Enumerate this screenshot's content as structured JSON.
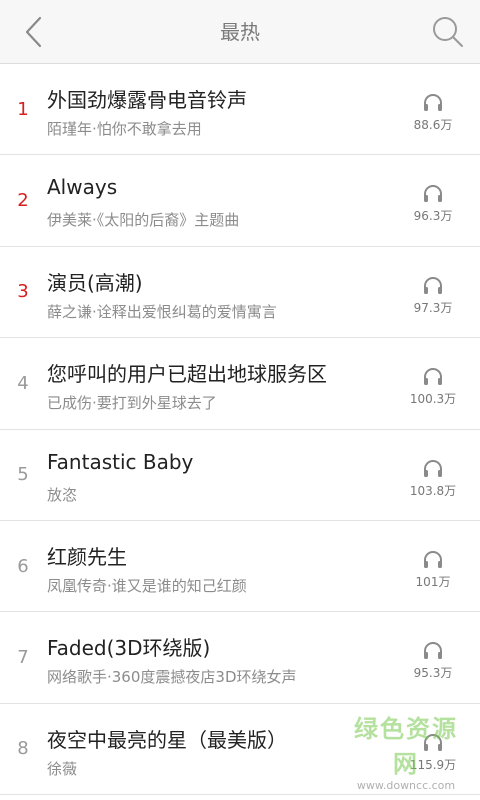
{
  "header": {
    "title": "最热"
  },
  "songs": [
    {
      "rank": "1",
      "title": "外国劲爆露骨电音铃声",
      "subtitle": "陌瑾年·怕你不敢拿去用",
      "plays": "88.6万"
    },
    {
      "rank": "2",
      "title": "Always",
      "subtitle": "伊美莱·《太阳的后裔》主题曲",
      "plays": "96.3万"
    },
    {
      "rank": "3",
      "title": "演员(高潮)",
      "subtitle": "薛之谦·诠释出爱恨纠葛的爱情寓言",
      "plays": "97.3万"
    },
    {
      "rank": "4",
      "title": "您呼叫的用户已超出地球服务区",
      "subtitle": "已成伤·要打到外星球去了",
      "plays": "100.3万"
    },
    {
      "rank": "5",
      "title": "Fantastic Baby",
      "subtitle": "放恣",
      "plays": "103.8万"
    },
    {
      "rank": "6",
      "title": "红颜先生",
      "subtitle": "凤凰传奇·谁又是谁的知己红颜",
      "plays": "101万"
    },
    {
      "rank": "7",
      "title": "Faded(3D环绕版)",
      "subtitle": "网络歌手·360度震撼夜店3D环绕女声",
      "plays": "95.3万"
    },
    {
      "rank": "8",
      "title": "夜空中最亮的星（最美版）",
      "subtitle": "徐薇",
      "plays": "115.9万"
    }
  ],
  "watermark": {
    "main": "绿色资源网",
    "url": "www.downcc.com"
  },
  "colors": {
    "top_rank": "#d81e1e",
    "rank": "#9a9a9a",
    "title": "#222222",
    "subtitle": "#8c8c8c"
  },
  "icons": {
    "back": "chevron-left-icon",
    "search": "search-icon",
    "plays": "headphones-icon"
  }
}
